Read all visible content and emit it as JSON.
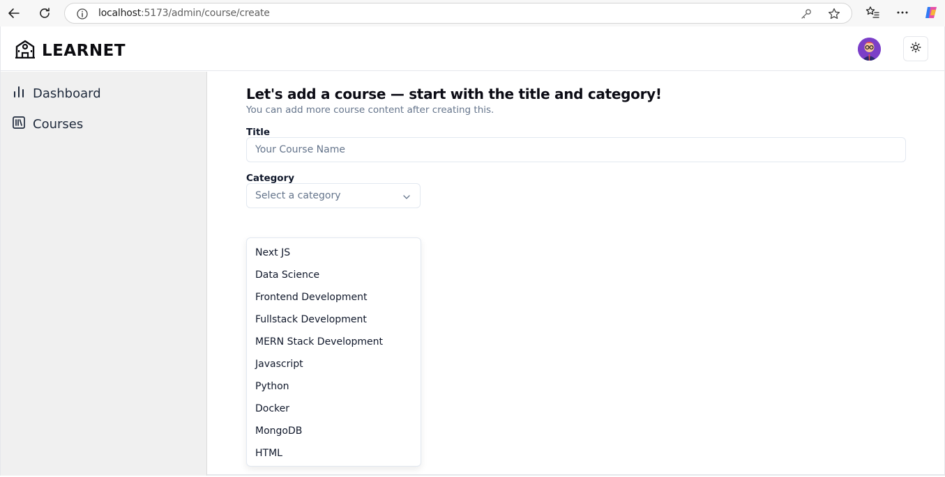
{
  "browser": {
    "url_host": "localhost",
    "url_path": ":5173/admin/course/create"
  },
  "app": {
    "brand": "LEARNET"
  },
  "sidebar": {
    "items": [
      {
        "label": "Dashboard",
        "icon": "bar-chart-icon"
      },
      {
        "label": "Courses",
        "icon": "library-icon"
      }
    ]
  },
  "form": {
    "heading": "Let's add a course — start with the title and category!",
    "subheading": "You can add more course content after creating this.",
    "title_label": "Title",
    "title_placeholder": "Your Course Name",
    "category_label": "Category",
    "category_placeholder": "Select a category",
    "category_options": [
      "Next JS",
      "Data Science",
      "Frontend Development",
      "Fullstack Development",
      "MERN Stack Development",
      "Javascript",
      "Python",
      "Docker",
      "MongoDB",
      "HTML"
    ]
  },
  "colors": {
    "sidebar_bg": "#f0f0f0",
    "muted_text": "#64748b",
    "border": "#e2e8f0"
  }
}
